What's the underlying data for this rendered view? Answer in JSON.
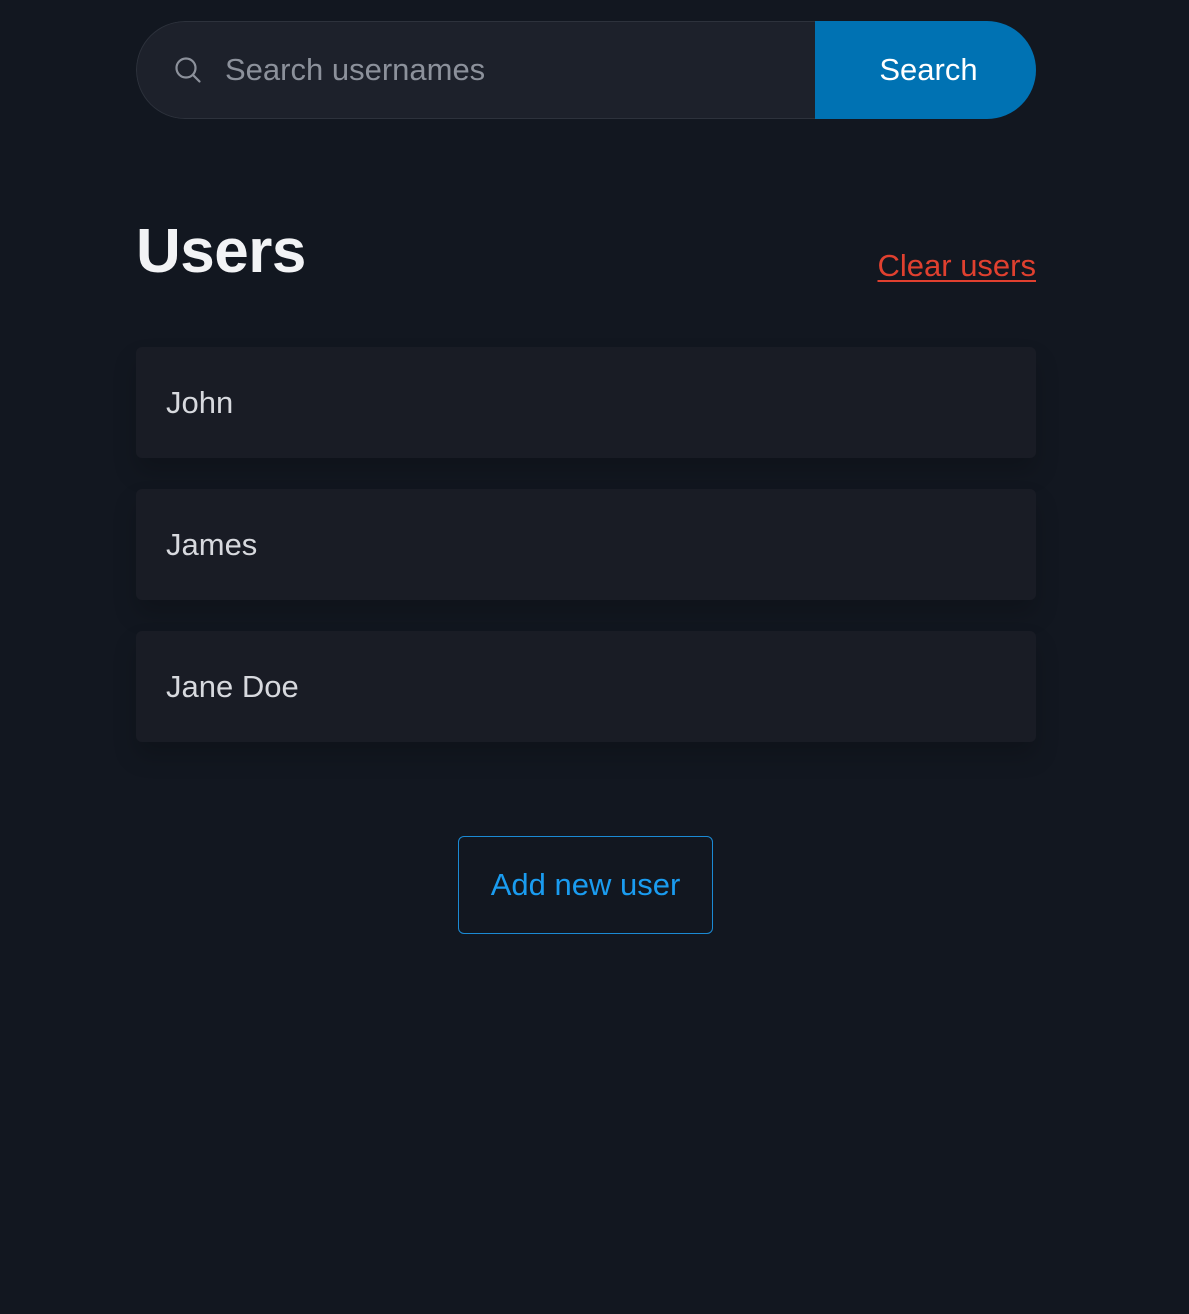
{
  "search": {
    "placeholder": "Search usernames",
    "value": "",
    "button_label": "Search",
    "icon": "search-icon"
  },
  "header": {
    "title": "Users",
    "clear_label": "Clear users"
  },
  "users": [
    {
      "name": "John"
    },
    {
      "name": "James"
    },
    {
      "name": "Jane Doe"
    }
  ],
  "actions": {
    "add_label": "Add new user"
  },
  "colors": {
    "background": "#121720",
    "accent": "#0072b3",
    "link_blue": "#1a9cf0",
    "danger": "#e0402f"
  }
}
